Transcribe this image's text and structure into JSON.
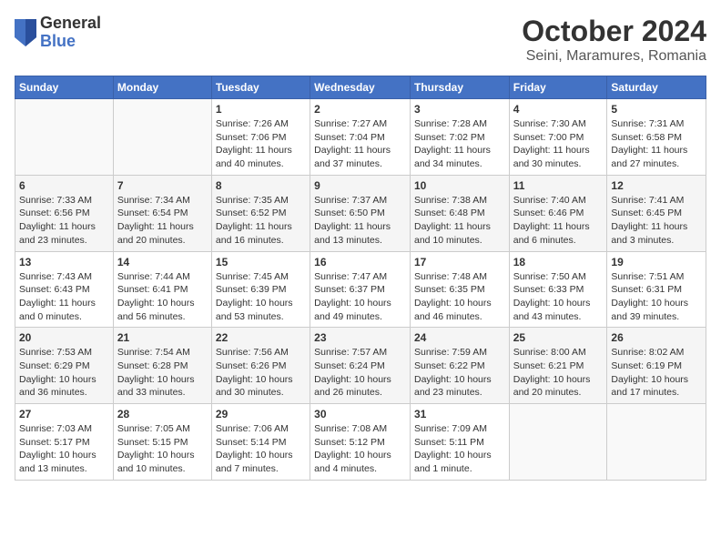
{
  "header": {
    "logo_line1": "General",
    "logo_line2": "Blue",
    "title": "October 2024",
    "subtitle": "Seini, Maramures, Romania"
  },
  "calendar": {
    "days_of_week": [
      "Sunday",
      "Monday",
      "Tuesday",
      "Wednesday",
      "Thursday",
      "Friday",
      "Saturday"
    ],
    "weeks": [
      [
        {
          "day": "",
          "info": ""
        },
        {
          "day": "",
          "info": ""
        },
        {
          "day": "1",
          "info": "Sunrise: 7:26 AM\nSunset: 7:06 PM\nDaylight: 11 hours\nand 40 minutes."
        },
        {
          "day": "2",
          "info": "Sunrise: 7:27 AM\nSunset: 7:04 PM\nDaylight: 11 hours\nand 37 minutes."
        },
        {
          "day": "3",
          "info": "Sunrise: 7:28 AM\nSunset: 7:02 PM\nDaylight: 11 hours\nand 34 minutes."
        },
        {
          "day": "4",
          "info": "Sunrise: 7:30 AM\nSunset: 7:00 PM\nDaylight: 11 hours\nand 30 minutes."
        },
        {
          "day": "5",
          "info": "Sunrise: 7:31 AM\nSunset: 6:58 PM\nDaylight: 11 hours\nand 27 minutes."
        }
      ],
      [
        {
          "day": "6",
          "info": "Sunrise: 7:33 AM\nSunset: 6:56 PM\nDaylight: 11 hours\nand 23 minutes."
        },
        {
          "day": "7",
          "info": "Sunrise: 7:34 AM\nSunset: 6:54 PM\nDaylight: 11 hours\nand 20 minutes."
        },
        {
          "day": "8",
          "info": "Sunrise: 7:35 AM\nSunset: 6:52 PM\nDaylight: 11 hours\nand 16 minutes."
        },
        {
          "day": "9",
          "info": "Sunrise: 7:37 AM\nSunset: 6:50 PM\nDaylight: 11 hours\nand 13 minutes."
        },
        {
          "day": "10",
          "info": "Sunrise: 7:38 AM\nSunset: 6:48 PM\nDaylight: 11 hours\nand 10 minutes."
        },
        {
          "day": "11",
          "info": "Sunrise: 7:40 AM\nSunset: 6:46 PM\nDaylight: 11 hours\nand 6 minutes."
        },
        {
          "day": "12",
          "info": "Sunrise: 7:41 AM\nSunset: 6:45 PM\nDaylight: 11 hours\nand 3 minutes."
        }
      ],
      [
        {
          "day": "13",
          "info": "Sunrise: 7:43 AM\nSunset: 6:43 PM\nDaylight: 11 hours\nand 0 minutes."
        },
        {
          "day": "14",
          "info": "Sunrise: 7:44 AM\nSunset: 6:41 PM\nDaylight: 10 hours\nand 56 minutes."
        },
        {
          "day": "15",
          "info": "Sunrise: 7:45 AM\nSunset: 6:39 PM\nDaylight: 10 hours\nand 53 minutes."
        },
        {
          "day": "16",
          "info": "Sunrise: 7:47 AM\nSunset: 6:37 PM\nDaylight: 10 hours\nand 49 minutes."
        },
        {
          "day": "17",
          "info": "Sunrise: 7:48 AM\nSunset: 6:35 PM\nDaylight: 10 hours\nand 46 minutes."
        },
        {
          "day": "18",
          "info": "Sunrise: 7:50 AM\nSunset: 6:33 PM\nDaylight: 10 hours\nand 43 minutes."
        },
        {
          "day": "19",
          "info": "Sunrise: 7:51 AM\nSunset: 6:31 PM\nDaylight: 10 hours\nand 39 minutes."
        }
      ],
      [
        {
          "day": "20",
          "info": "Sunrise: 7:53 AM\nSunset: 6:29 PM\nDaylight: 10 hours\nand 36 minutes."
        },
        {
          "day": "21",
          "info": "Sunrise: 7:54 AM\nSunset: 6:28 PM\nDaylight: 10 hours\nand 33 minutes."
        },
        {
          "day": "22",
          "info": "Sunrise: 7:56 AM\nSunset: 6:26 PM\nDaylight: 10 hours\nand 30 minutes."
        },
        {
          "day": "23",
          "info": "Sunrise: 7:57 AM\nSunset: 6:24 PM\nDaylight: 10 hours\nand 26 minutes."
        },
        {
          "day": "24",
          "info": "Sunrise: 7:59 AM\nSunset: 6:22 PM\nDaylight: 10 hours\nand 23 minutes."
        },
        {
          "day": "25",
          "info": "Sunrise: 8:00 AM\nSunset: 6:21 PM\nDaylight: 10 hours\nand 20 minutes."
        },
        {
          "day": "26",
          "info": "Sunrise: 8:02 AM\nSunset: 6:19 PM\nDaylight: 10 hours\nand 17 minutes."
        }
      ],
      [
        {
          "day": "27",
          "info": "Sunrise: 7:03 AM\nSunset: 5:17 PM\nDaylight: 10 hours\nand 13 minutes."
        },
        {
          "day": "28",
          "info": "Sunrise: 7:05 AM\nSunset: 5:15 PM\nDaylight: 10 hours\nand 10 minutes."
        },
        {
          "day": "29",
          "info": "Sunrise: 7:06 AM\nSunset: 5:14 PM\nDaylight: 10 hours\nand 7 minutes."
        },
        {
          "day": "30",
          "info": "Sunrise: 7:08 AM\nSunset: 5:12 PM\nDaylight: 10 hours\nand 4 minutes."
        },
        {
          "day": "31",
          "info": "Sunrise: 7:09 AM\nSunset: 5:11 PM\nDaylight: 10 hours\nand 1 minute."
        },
        {
          "day": "",
          "info": ""
        },
        {
          "day": "",
          "info": ""
        }
      ]
    ]
  }
}
